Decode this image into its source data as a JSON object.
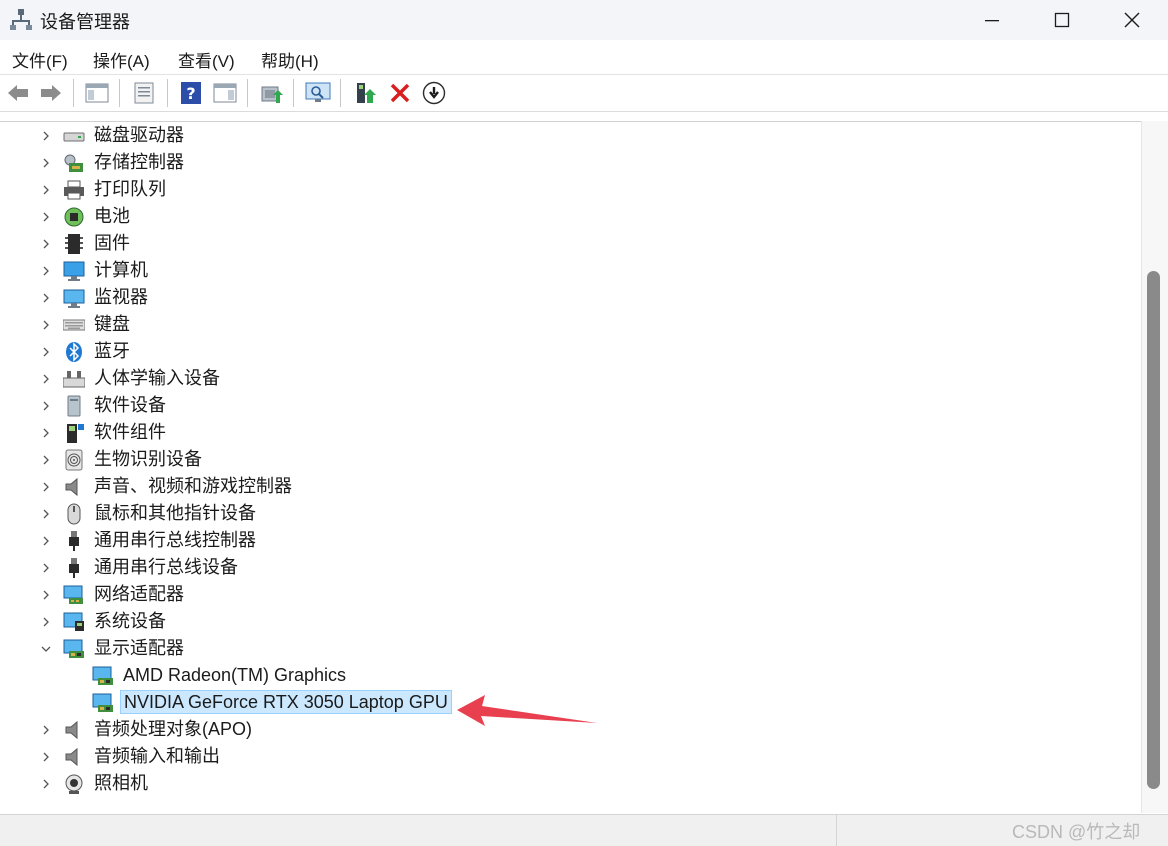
{
  "window": {
    "title": "设备管理器"
  },
  "menu": [
    "文件(F)",
    "操作(A)",
    "查看(V)",
    "帮助(H)"
  ],
  "toolbar": [
    "back-icon",
    "forward-icon",
    "show-hide-console-tree-icon",
    "properties-icon",
    "help-icon",
    "action-pane-icon",
    "update-driver-icon",
    "scan-hardware-icon",
    "enable-device-icon",
    "uninstall-device-icon",
    "disable-device-icon"
  ],
  "tree": [
    {
      "label": "磁盘驱动器",
      "icon": "disk-drive-icon",
      "expanded": false
    },
    {
      "label": "存储控制器",
      "icon": "storage-controller-icon",
      "expanded": false
    },
    {
      "label": "打印队列",
      "icon": "printer-icon",
      "expanded": false
    },
    {
      "label": "电池",
      "icon": "battery-icon",
      "expanded": false
    },
    {
      "label": "固件",
      "icon": "firmware-icon",
      "expanded": false
    },
    {
      "label": "计算机",
      "icon": "computer-icon",
      "expanded": false
    },
    {
      "label": "监视器",
      "icon": "monitor-icon",
      "expanded": false
    },
    {
      "label": "键盘",
      "icon": "keyboard-icon",
      "expanded": false
    },
    {
      "label": "蓝牙",
      "icon": "bluetooth-icon",
      "expanded": false
    },
    {
      "label": "人体学输入设备",
      "icon": "hid-icon",
      "expanded": false
    },
    {
      "label": "软件设备",
      "icon": "software-device-icon",
      "expanded": false
    },
    {
      "label": "软件组件",
      "icon": "software-component-icon",
      "expanded": false
    },
    {
      "label": "生物识别设备",
      "icon": "biometric-icon",
      "expanded": false
    },
    {
      "label": "声音、视频和游戏控制器",
      "icon": "speaker-icon",
      "expanded": false
    },
    {
      "label": "鼠标和其他指针设备",
      "icon": "mouse-icon",
      "expanded": false
    },
    {
      "label": "通用串行总线控制器",
      "icon": "usb-icon",
      "expanded": false
    },
    {
      "label": "通用串行总线设备",
      "icon": "usb-icon",
      "expanded": false
    },
    {
      "label": "网络适配器",
      "icon": "network-adapter-icon",
      "expanded": false
    },
    {
      "label": "系统设备",
      "icon": "system-device-icon",
      "expanded": false
    },
    {
      "label": "显示适配器",
      "icon": "display-adapter-icon",
      "expanded": true,
      "children": [
        {
          "label": "AMD Radeon(TM) Graphics",
          "icon": "display-adapter-icon"
        },
        {
          "label": "NVIDIA GeForce RTX 3050 Laptop GPU",
          "icon": "display-adapter-icon",
          "selected": true
        }
      ]
    },
    {
      "label": "音频处理对象(APO)",
      "icon": "speaker-icon",
      "expanded": false
    },
    {
      "label": "音频输入和输出",
      "icon": "speaker-icon",
      "expanded": false
    },
    {
      "label": "照相机",
      "icon": "camera-icon",
      "expanded": false
    }
  ],
  "watermark": "CSDN @竹之却",
  "colors": {
    "selection": "#cce8ff",
    "annotation_arrow": "#e8404f"
  }
}
